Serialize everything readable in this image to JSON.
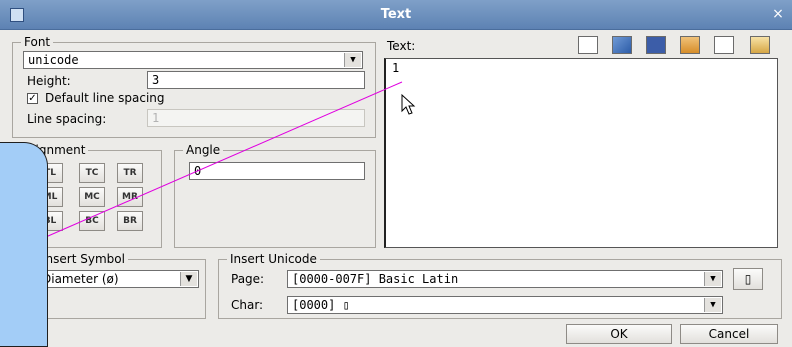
{
  "window": {
    "title": "Text",
    "close": "×"
  },
  "font": {
    "legend": "Font",
    "family_value": "unicode",
    "height_label": "Height:",
    "height_value": "3",
    "default_spacing_label": "Default line spacing",
    "default_spacing_checked": true,
    "line_spacing_label": "Line spacing:",
    "line_spacing_value": "1"
  },
  "alignment": {
    "legend": "Alignment",
    "buttons": [
      "TL",
      "TC",
      "TR",
      "ML",
      "MC",
      "MR",
      "BL",
      "BC",
      "BR"
    ]
  },
  "angle": {
    "legend": "Angle",
    "value": "0"
  },
  "text": {
    "label": "Text:",
    "content": "1",
    "toolbar": [
      "new-document-icon",
      "open-folder-icon",
      "save-disk-icon",
      "cut-icon",
      "copy-icon",
      "paste-icon"
    ]
  },
  "insert_symbol": {
    "legend": "Insert Symbol",
    "value": "Diameter (ø)"
  },
  "insert_unicode": {
    "legend": "Insert Unicode",
    "page_label": "Page:",
    "page_value": "[0000-007F] Basic Latin",
    "char_label": "Char:",
    "char_value": "[0000] ▯",
    "insert_button": "▯"
  },
  "buttons": {
    "ok": "OK",
    "cancel": "Cancel"
  },
  "colors": {
    "title_bar": "#6a8dbd",
    "dialog_bg": "#ecebe8",
    "guide_line": "#e000e0",
    "overlay": "#a3cdf7"
  }
}
